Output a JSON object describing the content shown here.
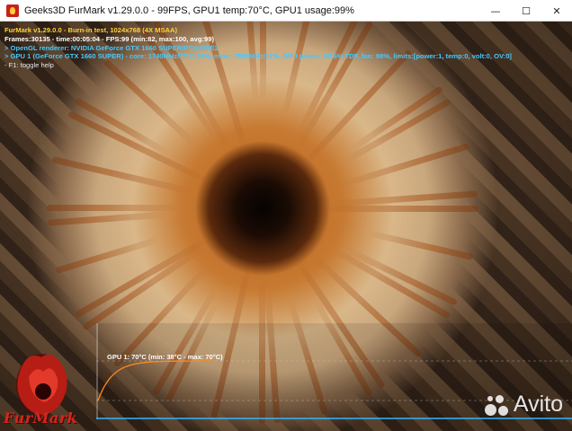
{
  "window": {
    "title": "Geeks3D FurMark v1.29.0.0 - 99FPS, GPU1 temp:70°C, GPU1 usage:99%",
    "icon": "furmark-app-icon",
    "controls": {
      "minimize": "—",
      "maximize": "☐",
      "close": "✕"
    }
  },
  "overlay": {
    "line1": "FurMark v1.29.0.0 - Burn-in test, 1024x768 (4X MSAA)",
    "line2": "Frames:30135 - time:00:05:04 - FPS:99 (min:82, max:100, avg:99)",
    "line3": "> OpenGL renderer: NVIDIA GeForce GTX 1660 SUPER/PCIe/SSE2",
    "line4": "> GPU 1 (GeForce GTX 1660 SUPER) - core: 1740MHz/70°C/99%, mem: 7000MHz/12%, GPU power: 98.6% TDP, fan: 98%, limits:[power:1, temp:0, volt:0, OV:0]",
    "line5": "- F1: toggle help"
  },
  "graph": {
    "label": "GPU 1: 70°C (min: 38°C - max: 70°C)",
    "min_c": 38,
    "max_c": 70,
    "current_c": 70,
    "curve_color": "#ff8a1e",
    "baseline_color": "#35b6ff"
  },
  "logos": {
    "furmark": "FurMark",
    "watermark": "Avito"
  }
}
